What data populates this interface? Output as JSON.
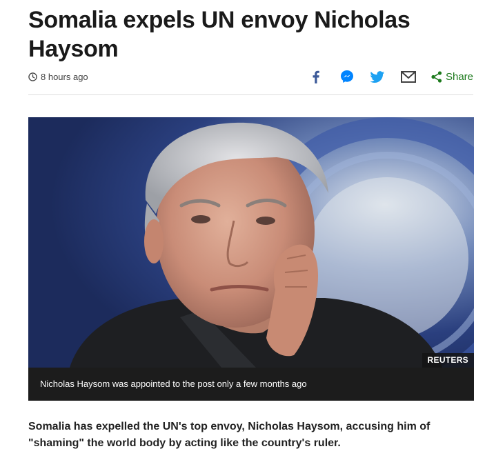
{
  "article": {
    "headline": "Somalia expels UN envoy Nicholas Haysom",
    "timestamp": "8 hours ago",
    "image": {
      "credit": "REUTERS",
      "caption": "Nicholas Haysom was appointed to the post only a few months ago"
    },
    "intro": "Somalia has expelled the UN's top envoy, Nicholas Haysom, accusing him of \"shaming\" the world body by acting like the country's ruler."
  },
  "share_tools": {
    "icons": [
      "facebook-icon",
      "messenger-icon",
      "twitter-icon",
      "email-icon",
      "share-icon"
    ],
    "share_label": "Share"
  },
  "colors": {
    "facebook": "#3b5998",
    "messenger": "#0084ff",
    "twitter": "#1da1f2",
    "email": "#404040",
    "share": "#1d7a1d"
  }
}
